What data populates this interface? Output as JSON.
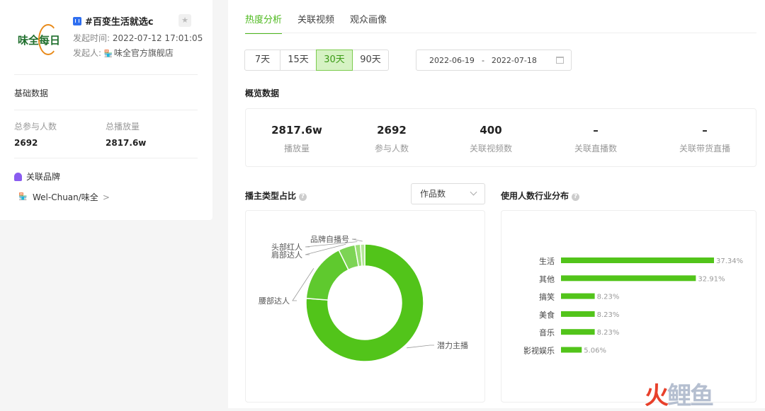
{
  "topic": {
    "logo_text": "味全每日",
    "title": "#百变生活就选c",
    "start_label": "发起时间:",
    "start_time": "2022-07-12 17:01:05",
    "initiator_label": "发起人:",
    "initiator": "味全官方旗舰店"
  },
  "basic": {
    "heading": "基础数据",
    "participants_label": "总参与人数",
    "participants_value": "2692",
    "plays_label": "总播放量",
    "plays_value": "2817.6w"
  },
  "brand": {
    "heading": "关联品牌",
    "name": "Wel-Chuan/味全",
    "arrow": ">"
  },
  "tabs": [
    "热度分析",
    "关联视频",
    "观众画像"
  ],
  "ranges": [
    "7天",
    "15天",
    "30天",
    "90天"
  ],
  "selected_range": "30天",
  "date_range": {
    "start": "2022-06-19",
    "sep": "-",
    "end": "2022-07-18"
  },
  "overview": {
    "heading": "概览数据",
    "items": [
      {
        "value": "2817.6w",
        "label": "播放量"
      },
      {
        "value": "2692",
        "label": "参与人数"
      },
      {
        "value": "400",
        "label": "关联视频数"
      },
      {
        "value": "–",
        "label": "关联直播数"
      },
      {
        "value": "–",
        "label": "关联带货直播"
      }
    ]
  },
  "creator_type": {
    "heading": "播主类型占比",
    "select": "作品数"
  },
  "industry": {
    "heading": "使用人数行业分布"
  },
  "watermark": {
    "a": "火",
    "b": "鲤鱼"
  },
  "chart_data": [
    {
      "type": "pie",
      "donut": true,
      "labels": [
        "潜力主播",
        "腰部达人",
        "肩部达人",
        "头部红人",
        "品牌自播号"
      ],
      "values": [
        76.2,
        16.5,
        4.6,
        1.5,
        1.2
      ],
      "colors": [
        "#52c41a",
        "#5fc92e",
        "#7dd455",
        "#9ade75",
        "#b5e79a"
      ]
    },
    {
      "type": "bar",
      "orientation": "horizontal",
      "categories": [
        "生活",
        "其他",
        "搞笑",
        "美食",
        "音乐",
        "影视娱乐"
      ],
      "values": [
        37.34,
        32.91,
        8.23,
        8.23,
        8.23,
        5.06
      ],
      "value_labels": [
        "37.34%",
        "32.91%",
        "8.23%",
        "8.23%",
        "8.23%",
        "5.06%"
      ],
      "color": "#52c41a"
    }
  ]
}
